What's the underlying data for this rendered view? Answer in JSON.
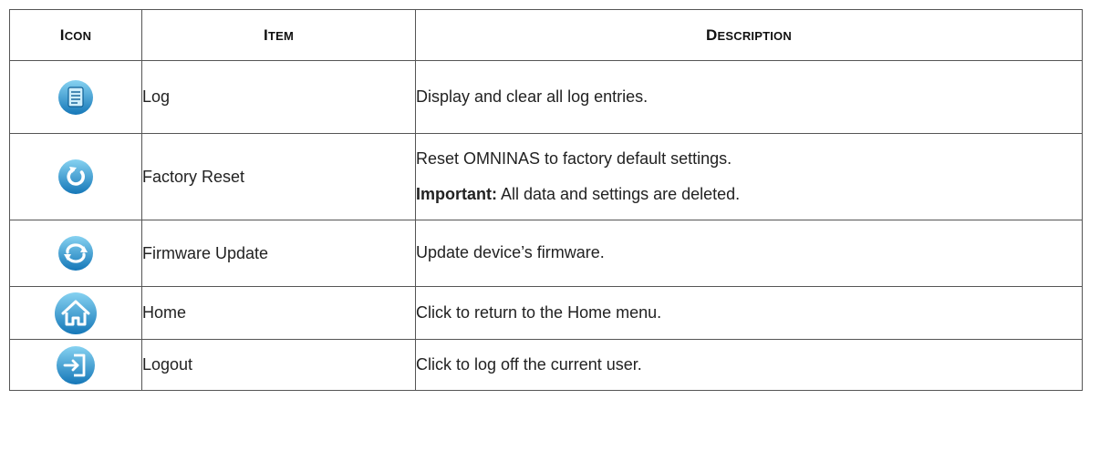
{
  "table": {
    "headers": {
      "icon": {
        "first": "I",
        "rest": "CON"
      },
      "item": {
        "first": "I",
        "rest": "TEM"
      },
      "description": {
        "first": "D",
        "rest": "ESCRIPTION"
      }
    },
    "rows": [
      {
        "icon": "log-icon",
        "item": "Log",
        "description": "Display and clear all log entries."
      },
      {
        "icon": "factory-reset-icon",
        "item": "Factory Reset",
        "description": "Reset OMNINAS to factory default settings.",
        "note_label": "Important:",
        "note_text": " All data and settings are deleted."
      },
      {
        "icon": "firmware-update-icon",
        "item": "Firmware Update",
        "description": "Update device’s firmware."
      },
      {
        "icon": "home-icon",
        "item": "Home",
        "description": "Click to return to the Home menu."
      },
      {
        "icon": "logout-icon",
        "item": "Logout",
        "description": "Click to log off the current user."
      }
    ]
  },
  "colors": {
    "icon_blue_light": "#6fc4ea",
    "icon_blue_dark": "#1577b8",
    "border": "#555555"
  }
}
